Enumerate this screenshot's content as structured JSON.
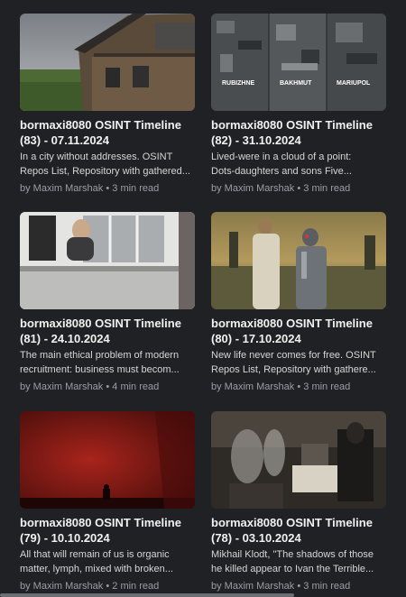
{
  "articles": [
    {
      "title_line1": "bormaxi8080 OSINT Timeline",
      "title_line2": "(83) - 07.11.2024",
      "excerpt_line1": "In a city without addresses. OSINT",
      "excerpt_line2": "Repos List, Repository with gathered...",
      "author": "by Maxim Marshak",
      "separator": "•",
      "read_time": "3 min read",
      "thumbnail": "abandoned-wooden-house"
    },
    {
      "title_line1": "bormaxi8080 OSINT Timeline",
      "title_line2": "(82) - 31.10.2024",
      "excerpt_line1": "Lived-were in a cloud of a point:",
      "excerpt_line2": "Dots-daughters and sons Five...",
      "author": "by Maxim Marshak",
      "separator": "•",
      "read_time": "3 min read",
      "thumbnail": "satellite-city-ruins",
      "thumb_labels": [
        "RUBIZHNE",
        "BAKHMUT",
        "MARIUPOL"
      ]
    },
    {
      "title_line1": "bormaxi8080 OSINT Timeline",
      "title_line2": "(81) - 24.10.2024",
      "excerpt_line1": "The main ethical problem of modern",
      "excerpt_line2": "recruitment: business must becom...",
      "author": "by Maxim Marshak",
      "separator": "•",
      "read_time": "4 min read",
      "thumbnail": "balcony-figure"
    },
    {
      "title_line1": "bormaxi8080 OSINT Timeline",
      "title_line2": "(80) - 17.10.2024",
      "excerpt_line1": "New life never comes for free. OSINT",
      "excerpt_line2": "Repos List, Repository with gathere...",
      "author": "by Maxim Marshak",
      "separator": "•",
      "read_time": "3 min read",
      "thumbnail": "robed-figure-and-robot-in-water"
    },
    {
      "title_line1": "bormaxi8080 OSINT Timeline",
      "title_line2": "(79) - 10.10.2024",
      "excerpt_line1": "All that will remain of us is organic",
      "excerpt_line2": "matter, lymph, mixed with broken...",
      "author": "by Maxim Marshak",
      "separator": "•",
      "read_time": "2 min read",
      "thumbnail": "red-silhouette"
    },
    {
      "title_line1": "bormaxi8080 OSINT Timeline",
      "title_line2": "(78) - 03.10.2024",
      "excerpt_line1": "Mikhail Klodt, \"The shadows of those",
      "excerpt_line2": "he killed appear to Ivan the Terrible...",
      "author": "by Maxim Marshak",
      "separator": "•",
      "read_time": "3 min read",
      "thumbnail": "klodt-painting-shadows"
    }
  ],
  "colors": {
    "background": "#1f2124",
    "title": "#f1f1f1",
    "excerpt": "#d6d6d6",
    "meta": "#9b9ea3"
  }
}
